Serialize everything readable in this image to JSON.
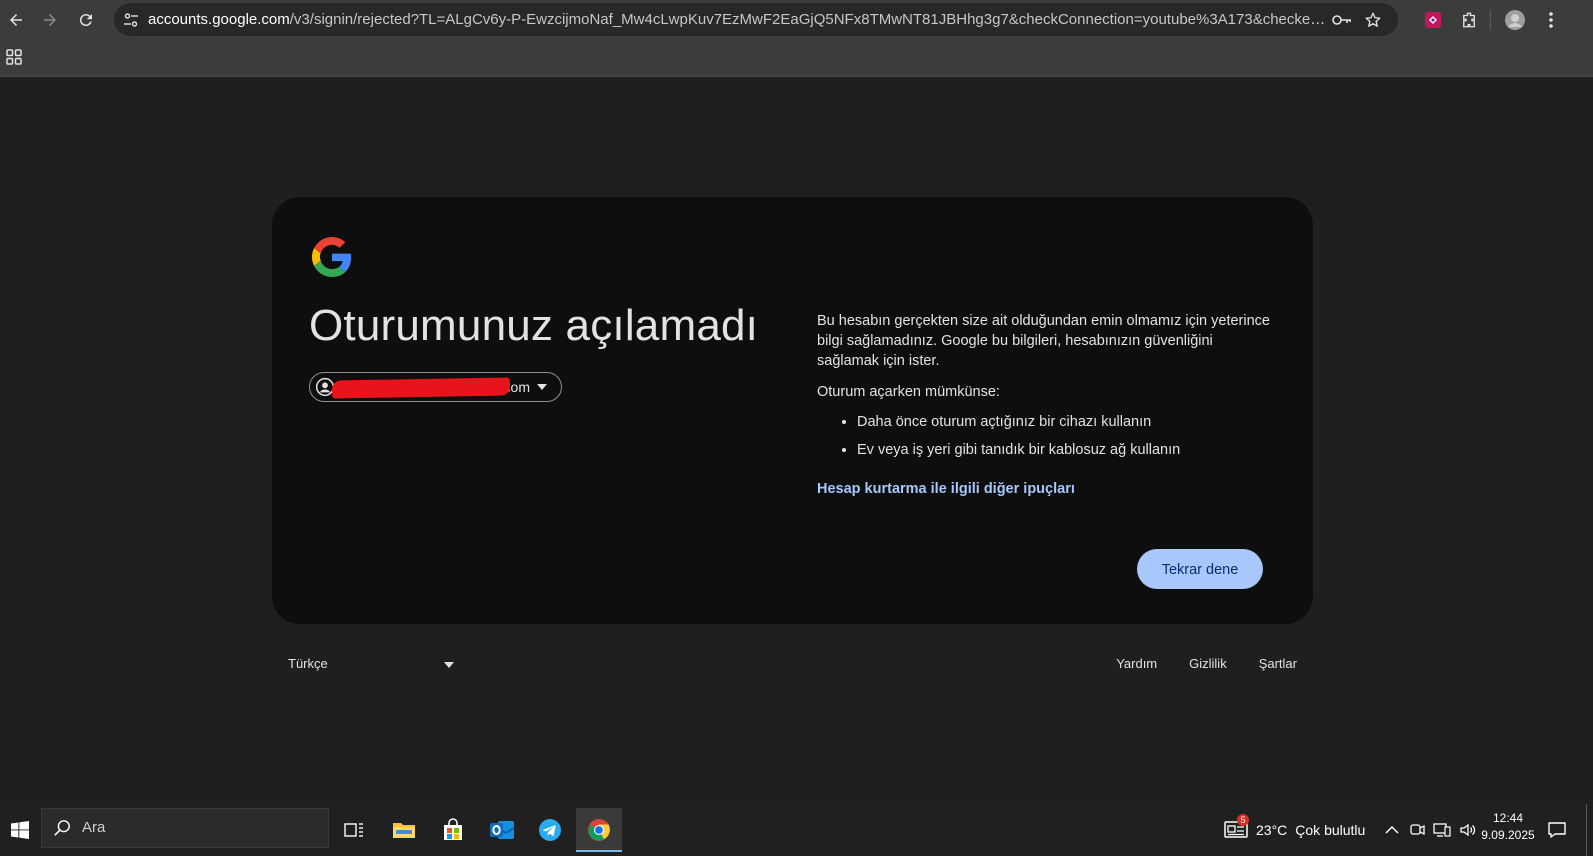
{
  "browser": {
    "url_host": "accounts.google.com",
    "url_path": "/v3/signin/rejected?TL=ALgCv6y-P-EwzcijmoNaf_Mw4cLwpKuv7EzMwF2EaGjQ5NFx8TMwNT81JBHhg3g7&checkConnection=youtube%3A173&checkedDomains=youtub..."
  },
  "card": {
    "headline": "Oturumunuz açılamadı",
    "account_email": "@gmail.com",
    "intro": "Bu hesabın gerçekten size ait olduğundan emin olmamız için yeterince bilgi sağlamadınız. Google bu bilgileri, hesabınızın güvenliğini sağlamak için ister.",
    "tip_heading": "Oturum açarken mümkünse:",
    "tips": [
      "Daha önce oturum açtığınız bir cihazı kullanın",
      "Ev veya iş yeri gibi tanıdık bir kablosuz ağ kullanın"
    ],
    "recovery_link": "Hesap kurtarma ile ilgili diğer ipuçları",
    "retry_button": "Tekrar dene"
  },
  "footer": {
    "language": "Türkçe",
    "links": [
      "Yardım",
      "Gizlilik",
      "Şartlar"
    ]
  },
  "taskbar": {
    "search_placeholder": "Ara",
    "weather_badge": "5",
    "weather_temp": "23°C",
    "weather_desc": "Çok bulutlu",
    "time": "12:44",
    "date": "9.09.2025"
  },
  "colors": {
    "accent": "#a8c7fa",
    "card_bg": "#0e0e0e",
    "page_bg": "#1f1f1f",
    "redaction": "#e8141c"
  }
}
